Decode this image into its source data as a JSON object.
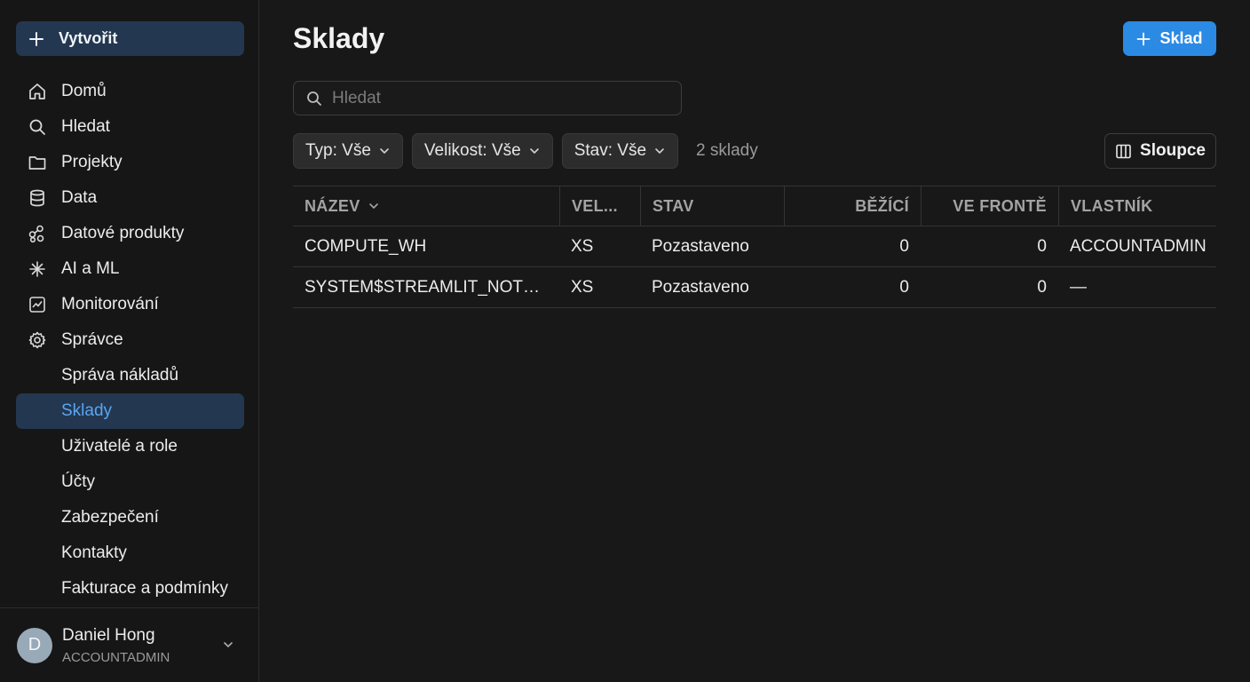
{
  "sidebar": {
    "create_label": "Vytvořit",
    "items": [
      {
        "label": "Domů",
        "icon": "home-icon"
      },
      {
        "label": "Hledat",
        "icon": "search-icon"
      },
      {
        "label": "Projekty",
        "icon": "folder-icon"
      },
      {
        "label": "Data",
        "icon": "database-icon"
      },
      {
        "label": "Datové produkty",
        "icon": "data-products-icon"
      },
      {
        "label": "AI a ML",
        "icon": "ai-sparkle-icon"
      },
      {
        "label": "Monitorování",
        "icon": "monitoring-chart-icon"
      },
      {
        "label": "Správce",
        "icon": "gear-icon"
      }
    ],
    "sub_items": [
      {
        "label": "Správa nákladů"
      },
      {
        "label": "Sklady",
        "active": true
      },
      {
        "label": "Uživatelé a role"
      },
      {
        "label": "Účty"
      },
      {
        "label": "Zabezpečení"
      },
      {
        "label": "Kontakty"
      },
      {
        "label": "Fakturace a podmínky"
      }
    ],
    "user": {
      "initial": "D",
      "name": "Daniel Hong",
      "role": "ACCOUNTADMIN"
    }
  },
  "header": {
    "title": "Sklady",
    "add_label": "Sklad"
  },
  "search": {
    "placeholder": "Hledat",
    "value": ""
  },
  "filters": {
    "type_label": "Typ: Vše",
    "size_label": "Velikost: Vše",
    "state_label": "Stav: Vše",
    "count_text": "2 sklady",
    "columns_label": "Sloupce"
  },
  "table": {
    "headers": {
      "name": "NÁZEV",
      "size": "VEL...",
      "state": "STAV",
      "running": "BĚŽÍCÍ",
      "queued": "VE FRONTĚ",
      "owner": "VLASTNÍK"
    },
    "rows": [
      {
        "name": "COMPUTE_WH",
        "size": "XS",
        "state": "Pozastaveno",
        "running": "0",
        "queued": "0",
        "owner": "ACCOUNTADMIN"
      },
      {
        "name": "SYSTEM$STREAMLIT_NOTEB...",
        "size": "XS",
        "state": "Pozastaveno",
        "running": "0",
        "queued": "0",
        "owner": "—"
      }
    ]
  },
  "colors": {
    "accent": "#2b8ae4",
    "active_bg": "#243750",
    "active_text": "#5aa6f0",
    "background": "#181818"
  }
}
